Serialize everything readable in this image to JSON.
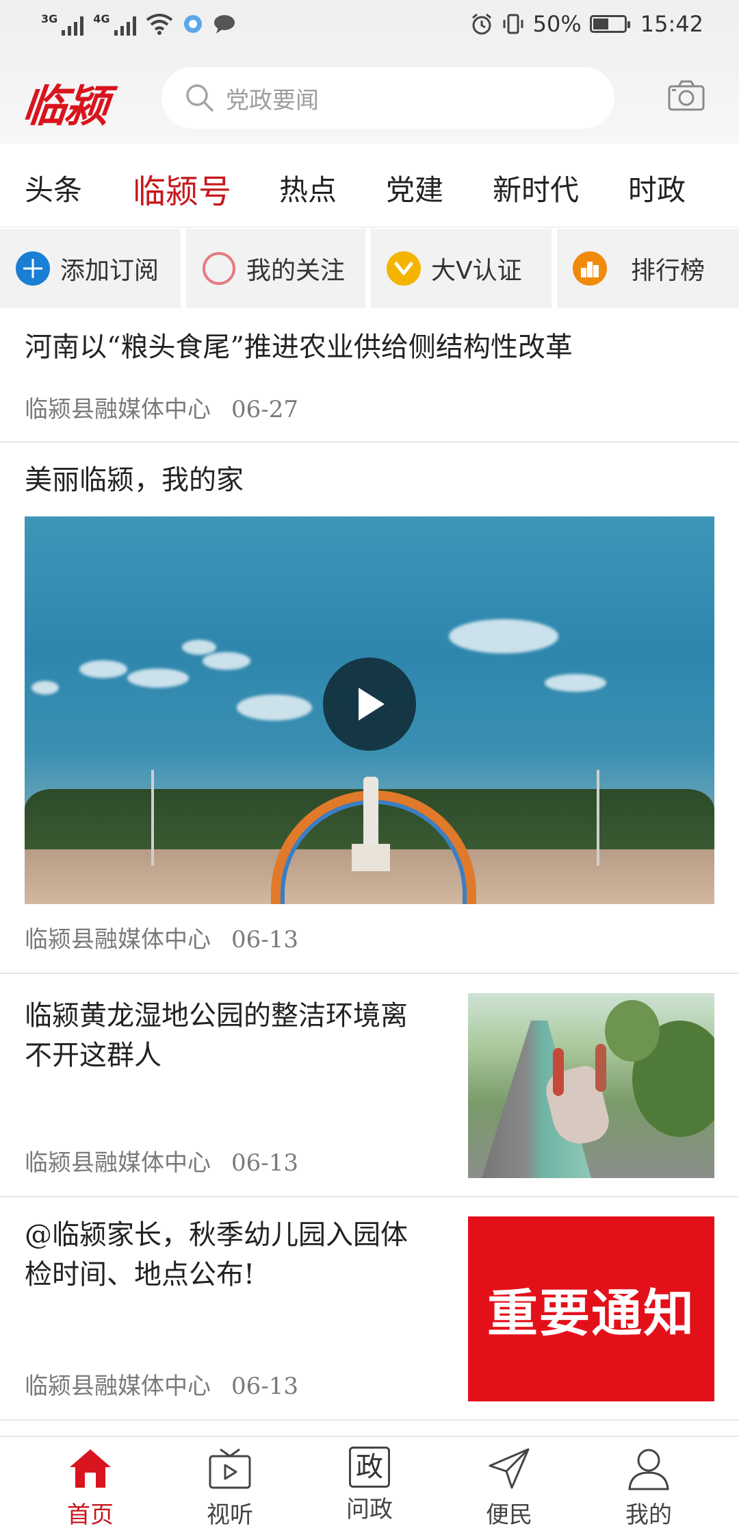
{
  "status_bar": {
    "signal_1": "3G",
    "signal_2": "4G",
    "battery_percent": "50%",
    "battery_level": 0.5,
    "time": "15:42"
  },
  "header": {
    "logo_text": "临颍",
    "search_placeholder": "党政要闻",
    "camera_icon": "camera-icon"
  },
  "tabs": [
    {
      "label": "头条"
    },
    {
      "label": "临颍号",
      "active": true
    },
    {
      "label": "热点"
    },
    {
      "label": "党建"
    },
    {
      "label": "新时代"
    },
    {
      "label": "时政"
    }
  ],
  "quick_buttons": [
    {
      "label": "添加订阅",
      "icon": "plus-circle-icon",
      "color": "#1a7fd4"
    },
    {
      "label": "我的关注",
      "icon": "ring-icon",
      "color": "#e57a80"
    },
    {
      "label": "大V认证",
      "icon": "v-badge-icon",
      "color": "#f4b400"
    },
    {
      "label": "排行榜",
      "icon": "ranking-icon",
      "color": "#f08a0a"
    }
  ],
  "articles": [
    {
      "title": "河南以“粮头食尾”推进农业供给侧结构性改革",
      "source": "临颍县融媒体中心",
      "date": "06-27"
    },
    {
      "title": "美丽临颍，我的家",
      "source": "临颍县融媒体中心",
      "date": "06-13"
    },
    {
      "title": "临颍黄龙湿地公园的整洁环境离不开这群人",
      "title_line1": "临颍黄龙湿地公园的整洁环境离",
      "title_line2": "不开这群人",
      "source": "临颍县融媒体中心",
      "date": "06-13"
    },
    {
      "title": "@临颍家长，秋季幼儿园入园体检时间、地点公布!",
      "title_line1": "@临颍家长，秋季幼儿园入园体",
      "title_line2": "检时间、地点公布!",
      "source": "临颍县融媒体中心",
      "date": "06-13",
      "thumb_text": "重要通知"
    }
  ],
  "bottom_nav": [
    {
      "label": "首页",
      "icon": "home-icon",
      "active": true
    },
    {
      "label": "视听",
      "icon": "tv-icon"
    },
    {
      "label": "问政",
      "icon": "gov-icon",
      "icon_text": "政"
    },
    {
      "label": "便民",
      "icon": "send-icon"
    },
    {
      "label": "我的",
      "icon": "user-icon"
    }
  ],
  "colors": {
    "brand_red": "#c8161d",
    "logo_red": "#d8141e",
    "notice_red": "#e3101a"
  }
}
